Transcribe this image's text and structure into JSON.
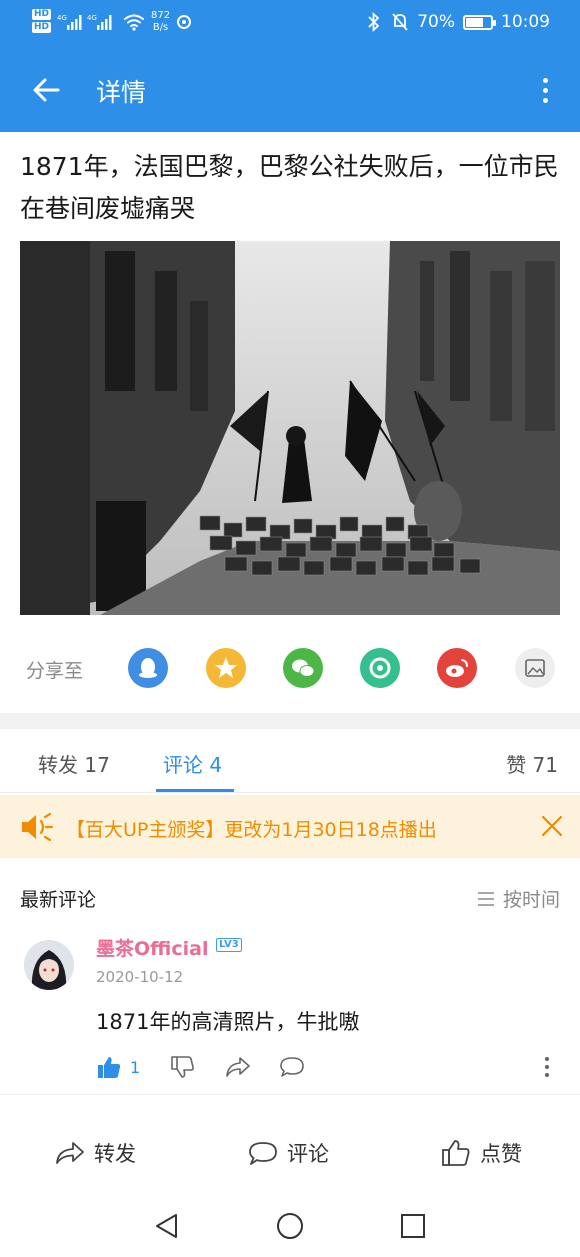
{
  "status_bar": {
    "hd_top": "HD",
    "hd_bottom": "HD",
    "network_speed_value": "872",
    "network_speed_unit": "B/s",
    "battery_percent": "70%",
    "battery_level": 0.7,
    "time": "10:09"
  },
  "app_bar": {
    "title": "详情"
  },
  "post": {
    "title": "1871年，法国巴黎，巴黎公社失败后，一位市民在巷间废墟痛哭"
  },
  "share": {
    "label": "分享至",
    "targets": [
      {
        "icon": "qq-icon",
        "color": "#3f8ee3"
      },
      {
        "icon": "qzone-icon",
        "color": "#f4b834"
      },
      {
        "icon": "wechat-icon",
        "color": "#4cb747"
      },
      {
        "icon": "moments-icon",
        "color": "#33c08e"
      },
      {
        "icon": "weibo-icon",
        "color": "#e4433b"
      },
      {
        "icon": "save-image-icon",
        "color": "#eeeeee"
      }
    ]
  },
  "tabs": {
    "repost": "转发 17",
    "comments": "评论 4",
    "likes": "赞 71"
  },
  "notice": {
    "text": "【百大UP主颁奖】更改为1月30日18点播出"
  },
  "comments_section": {
    "title": "最新评论",
    "sort_label": "按时间"
  },
  "comment": {
    "username": "墨茶Official",
    "level": "LV3",
    "date": "2020-10-12",
    "text": "1871年的高清照片，牛批嗷",
    "like_count": "1"
  },
  "bottom_bar": {
    "repost": "转发",
    "comment": "评论",
    "like": "点赞"
  },
  "colors": {
    "brand_blue": "#2d8fe8",
    "notice_bg": "#fdf3dc",
    "notice_text": "#f08c00",
    "username_pink": "#ea6d92"
  }
}
